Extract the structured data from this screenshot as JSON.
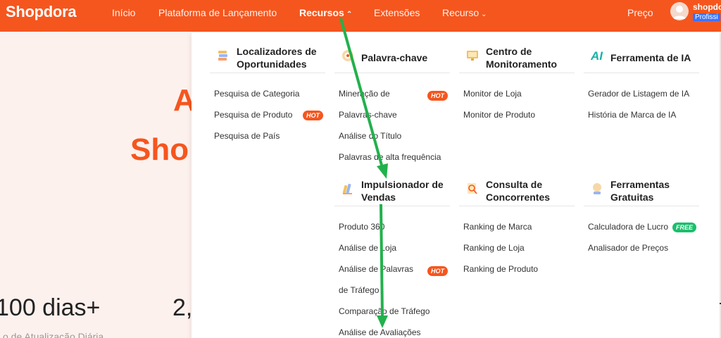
{
  "topbar": {
    "logo": "Shopdora",
    "nav": [
      {
        "label": "Início"
      },
      {
        "label": "Plataforma de Lançamento"
      },
      {
        "label": "Recursos",
        "chevron": "^"
      },
      {
        "label": "Extensões"
      },
      {
        "label": "Recurso",
        "chevron": "v"
      }
    ],
    "price": "Preço",
    "user_name": "shopdo",
    "user_badge": "Profissi"
  },
  "hero": {
    "line1": "A",
    "line2": "Sho",
    "stat1": "100 dias+",
    "stat2": "2,",
    "stat_label": "o de Atualização Diária"
  },
  "menu": {
    "sections": [
      {
        "title": "Localizadores de Oportunidades",
        "icon": "opportunity-icon",
        "links": [
          {
            "label": "Pesquisa de Categoria"
          },
          {
            "label": "Pesquisa de Produto",
            "badge": "HOT"
          },
          {
            "label": "Pesquisa de País"
          }
        ]
      },
      {
        "title": "Palavra-chave",
        "icon": "keyword-icon",
        "links": [
          {
            "label": "Mineração de Palavras-chave",
            "badge": "HOT"
          },
          {
            "label": "Análise do Título"
          },
          {
            "label": "Palavras de alta frequência"
          }
        ]
      },
      {
        "title": "Centro de Monitoramento",
        "icon": "monitor-icon",
        "links": [
          {
            "label": "Monitor de Loja"
          },
          {
            "label": "Monitor de Produto"
          }
        ]
      },
      {
        "title": "Ferramenta de IA",
        "icon": "ai-icon",
        "links": [
          {
            "label": "Gerador de Listagem de IA"
          },
          {
            "label": "História de Marca de IA"
          }
        ]
      },
      {
        "title": "Impulsionador de Vendas",
        "icon": "sales-booster-icon",
        "links": [
          {
            "label": "Produto 360"
          },
          {
            "label": "Análise de Loja"
          },
          {
            "label": "Análise de Palavras de Tráfego",
            "badge": "HOT"
          },
          {
            "label": "Comparação de Tráfego"
          },
          {
            "label": "Análise de Avaliações"
          }
        ]
      },
      {
        "title": "Consulta de Concorrentes",
        "icon": "competitor-icon",
        "links": [
          {
            "label": "Ranking de Marca"
          },
          {
            "label": "Ranking de Loja"
          },
          {
            "label": "Ranking de Produto"
          }
        ]
      },
      {
        "title": "Ferramentas Gratuitas",
        "icon": "free-tools-icon",
        "links": [
          {
            "label": "Calculadora de Lucro",
            "badge": "FREE"
          },
          {
            "label": "Analisador de Preços"
          }
        ]
      }
    ]
  },
  "colors": {
    "brand": "#f5561e",
    "arrow": "#22b14c",
    "free": "#1bbf6b",
    "user_badge": "#3c72ff"
  }
}
